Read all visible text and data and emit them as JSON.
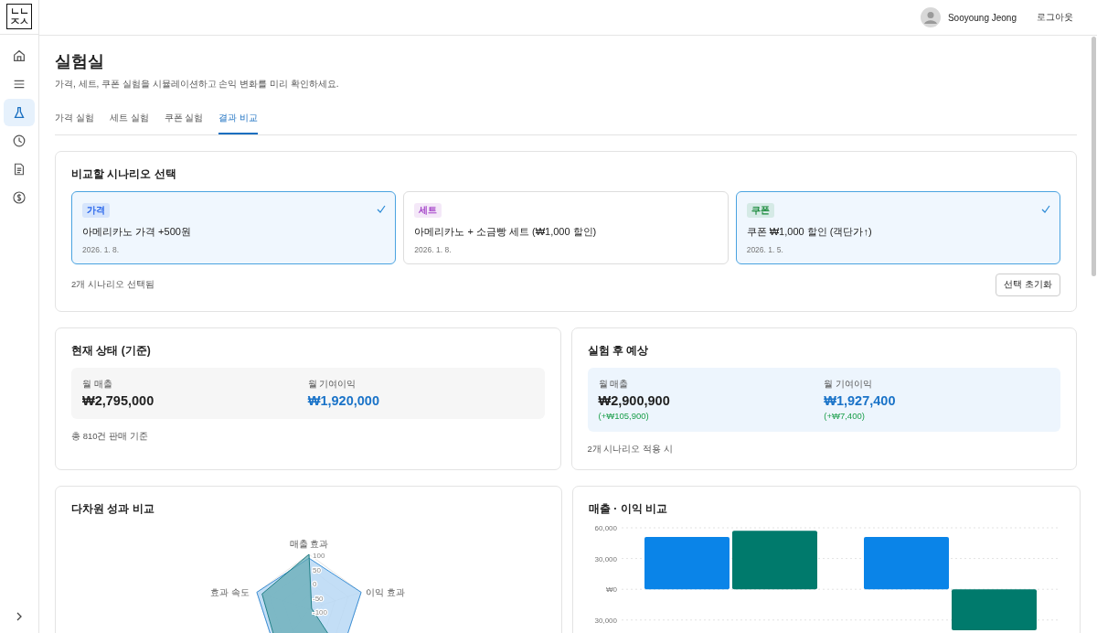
{
  "logo": [
    "ㄴㄴ",
    "ㅈㅅ"
  ],
  "sidebar": {
    "items": [
      {
        "kind": "home",
        "selected": false
      },
      {
        "kind": "menu",
        "selected": false
      },
      {
        "kind": "flask",
        "selected": true
      },
      {
        "kind": "clock",
        "selected": false
      },
      {
        "kind": "document",
        "selected": false
      },
      {
        "kind": "dollar",
        "selected": false
      }
    ]
  },
  "header": {
    "user": "Sooyoung Jeong",
    "logout": "로그아웃"
  },
  "page": {
    "title": "실험실",
    "subtitle": "가격, 세트, 쿠폰 실험을 시뮬레이션하고 손익 변화를 미리 확인하세요."
  },
  "tabs": [
    {
      "label": "가격 실험",
      "selected": false
    },
    {
      "label": "세트 실험",
      "selected": false
    },
    {
      "label": "쿠폰 실험",
      "selected": false
    },
    {
      "label": "결과 비교",
      "selected": true
    }
  ],
  "scenario_select": {
    "title": "비교할 시나리오 선택",
    "scenarios": [
      {
        "tag": "가격",
        "color": "#2563eb",
        "name": "아메리카노 가격 +500원",
        "date": "2026. 1. 8.",
        "selected": true
      },
      {
        "tag": "세트",
        "color": "#a23fc7",
        "name": "아메리카노 + 소금빵 세트 (₩1,000 할인)",
        "date": "2026. 1. 8.",
        "selected": false
      },
      {
        "tag": "쿠폰",
        "color": "#1a8a3c",
        "name": "쿠폰 ₩1,000 할인 (객단가↑)",
        "date": "2026. 1. 5.",
        "selected": true
      }
    ],
    "count": "2개 시나리오 선택됨",
    "reset": "선택 초기화"
  },
  "summaries": [
    {
      "kind": "current",
      "title": "현재 상태 (기준)",
      "metrics": [
        {
          "label": "월 매출",
          "value": "₩2,795,000"
        },
        {
          "label": "월 기여이익",
          "value": "₩1,920,000"
        }
      ],
      "note": "총 810건 판매 기준"
    },
    {
      "kind": "expected",
      "title": "실험 후 예상",
      "metrics": [
        {
          "label": "월 매출",
          "value": "₩2,900,900",
          "delta": "(+₩105,900)"
        },
        {
          "label": "월 기여이익",
          "value": "₩1,927,400",
          "delta": "(+₩7,400)"
        }
      ],
      "note": "2개 시나리오 적용 시"
    }
  ],
  "radar": {
    "title": "다차원 성과 비교",
    "axes": [
      "매출 효과",
      "이익 효과",
      "효과 속도"
    ],
    "ticks": [
      "100",
      "50",
      "0",
      "-50",
      "-100"
    ]
  },
  "bar_panel": {
    "title": "매출 · 이익 비교",
    "chart_data": {
      "type": "bar",
      "grid": true,
      "ylim": [
        -40000,
        60000
      ],
      "yticks": [
        {
          "value": 60000,
          "label": "60,000"
        },
        {
          "value": 30000,
          "label": "30,000"
        },
        {
          "value": 0,
          "label": "₩0"
        },
        {
          "value": -30000,
          "label": "30,000"
        }
      ],
      "series": [
        {
          "color": "#0a84e8",
          "values": [
            51000,
            51000
          ]
        },
        {
          "color": "#007a6c",
          "values": [
            57000,
            -40000
          ]
        }
      ]
    }
  }
}
